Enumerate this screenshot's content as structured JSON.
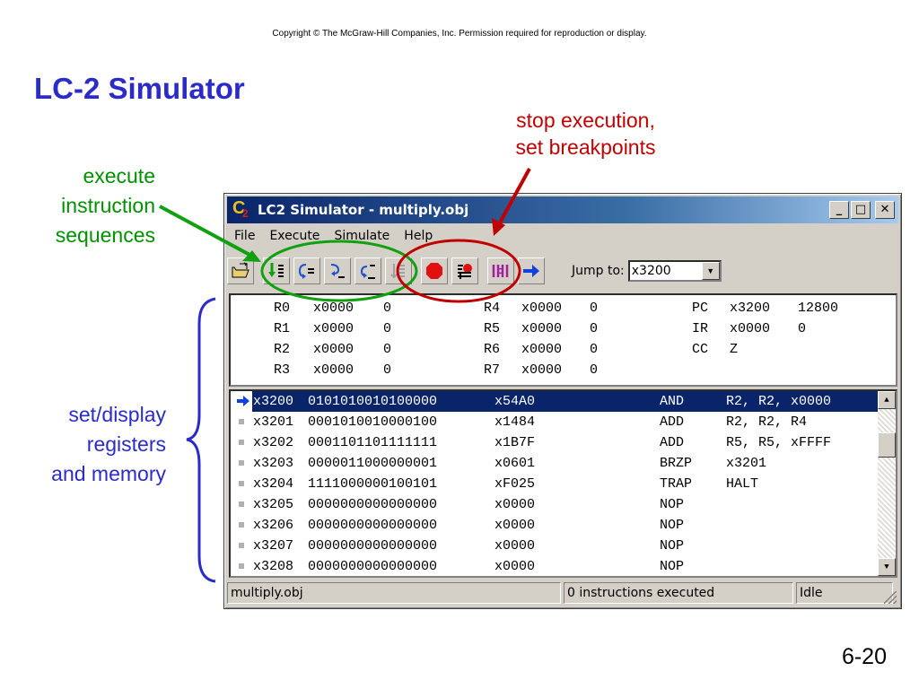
{
  "slide": {
    "copyright": "Copyright © The McGraw-Hill Companies, Inc.  Permission required for reproduction or display.",
    "title": "LC-2 Simulator",
    "annotation_stop": [
      "stop execution,",
      "set breakpoints"
    ],
    "annotation_execute": [
      "execute",
      "instruction",
      "sequences"
    ],
    "annotation_regs": [
      "set/display",
      "registers",
      "and memory"
    ],
    "page_number": "6-20"
  },
  "window": {
    "title": "LC2 Simulator - multiply.obj",
    "minimize": "_",
    "maximize": "□",
    "close": "✕",
    "menu": [
      "File",
      "Execute",
      "Simulate",
      "Help"
    ]
  },
  "toolbar": {
    "icons": [
      "open-file-icon",
      "step-icon",
      "step-into-icon",
      "step-over-icon",
      "step-out-icon",
      "disabled-step-icon",
      "stop-icon",
      "breakpoint-icon",
      "reset-icon",
      "go-arrow-icon"
    ],
    "jump_label": "Jump to:",
    "jump_value": "x3200"
  },
  "registers": {
    "rows": [
      {
        "a": "R0",
        "ah": "x0000",
        "ad": "0",
        "b": "R4",
        "bh": "x0000",
        "bd": "0",
        "c": "PC",
        "ch": "x3200",
        "cd": "12800"
      },
      {
        "a": "R1",
        "ah": "x0000",
        "ad": "0",
        "b": "R5",
        "bh": "x0000",
        "bd": "0",
        "c": "IR",
        "ch": "x0000",
        "cd": "0"
      },
      {
        "a": "R2",
        "ah": "x0000",
        "ad": "0",
        "b": "R6",
        "bh": "x0000",
        "bd": "0",
        "c": "CC",
        "ch": "Z",
        "cd": ""
      },
      {
        "a": "R3",
        "ah": "x0000",
        "ad": "0",
        "b": "R7",
        "bh": "x0000",
        "bd": "0",
        "c": "",
        "ch": "",
        "cd": ""
      }
    ]
  },
  "memory": {
    "rows": [
      {
        "addr": "x3200",
        "bin": "0101010010100000",
        "hex": "x54A0",
        "op": "AND",
        "args": "R2, R2, x0000",
        "current": true
      },
      {
        "addr": "x3201",
        "bin": "0001010010000100",
        "hex": "x1484",
        "op": "ADD",
        "args": "R2, R2, R4",
        "current": false
      },
      {
        "addr": "x3202",
        "bin": "0001101101111111",
        "hex": "x1B7F",
        "op": "ADD",
        "args": "R5, R5, xFFFF",
        "current": false
      },
      {
        "addr": "x3203",
        "bin": "0000011000000001",
        "hex": "x0601",
        "op": "BRZP",
        "args": "x3201",
        "current": false
      },
      {
        "addr": "x3204",
        "bin": "1111000000100101",
        "hex": "xF025",
        "op": "TRAP",
        "args": "HALT",
        "current": false
      },
      {
        "addr": "x3205",
        "bin": "0000000000000000",
        "hex": "x0000",
        "op": "NOP",
        "args": "",
        "current": false
      },
      {
        "addr": "x3206",
        "bin": "0000000000000000",
        "hex": "x0000",
        "op": "NOP",
        "args": "",
        "current": false
      },
      {
        "addr": "x3207",
        "bin": "0000000000000000",
        "hex": "x0000",
        "op": "NOP",
        "args": "",
        "current": false
      },
      {
        "addr": "x3208",
        "bin": "0000000000000000",
        "hex": "x0000",
        "op": "NOP",
        "args": "",
        "current": false
      }
    ]
  },
  "status": {
    "file": "multiply.obj",
    "executed": "0 instructions executed",
    "state": "Idle"
  },
  "colors": {
    "title_blue": "#2b2bc8",
    "annotation_red": "#c00000",
    "annotation_green": "#009000",
    "selection": "#0a246a"
  }
}
